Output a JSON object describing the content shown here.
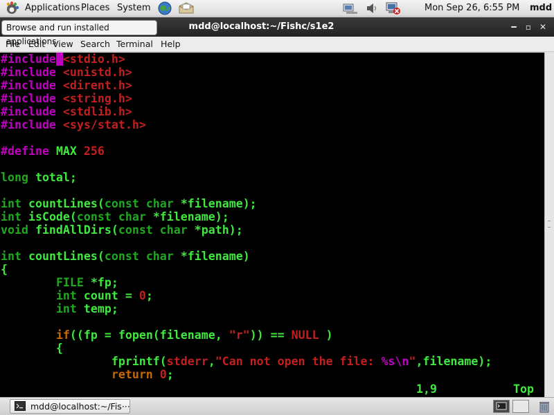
{
  "top_panel": {
    "menus": [
      "Applications",
      "Places",
      "System"
    ],
    "launchers": [
      "web-browser-icon",
      "mail-client-icon"
    ],
    "tray": [
      "network-icon",
      "volume-icon",
      "update-notifier-icon"
    ],
    "clock": "Mon Sep 26,  6:55 PM",
    "user": "mdd"
  },
  "tooltip": "Browse and run installed applications",
  "window": {
    "title": "mdd@localhost:~/Fishc/s1e2",
    "menu": [
      "File",
      "Edit",
      "View",
      "Search",
      "Terminal",
      "Help"
    ]
  },
  "editor": {
    "lines": [
      [
        [
          "pp",
          "#include"
        ],
        [
          "inc",
          "<stdio.h>"
        ]
      ],
      [
        [
          "pp",
          "#include "
        ],
        [
          "inc",
          "<unistd.h>"
        ]
      ],
      [
        [
          "pp",
          "#include "
        ],
        [
          "inc",
          "<dirent.h>"
        ]
      ],
      [
        [
          "pp",
          "#include "
        ],
        [
          "inc",
          "<string.h>"
        ]
      ],
      [
        [
          "pp",
          "#include "
        ],
        [
          "inc",
          "<stdlib.h>"
        ]
      ],
      [
        [
          "pp",
          "#include "
        ],
        [
          "inc",
          "<sys/stat.h>"
        ]
      ],
      [],
      [
        [
          "pp",
          "#define "
        ],
        [
          "id",
          "MAX "
        ],
        [
          "st",
          "256"
        ]
      ],
      [],
      [
        [
          "ty",
          "long "
        ],
        [
          "id",
          "total;"
        ]
      ],
      [],
      [
        [
          "ty",
          "int "
        ],
        [
          "id",
          "countLines("
        ],
        [
          "ty",
          "const char "
        ],
        [
          "id",
          "*filename);"
        ]
      ],
      [
        [
          "ty",
          "int "
        ],
        [
          "id",
          "isCode("
        ],
        [
          "ty",
          "const char "
        ],
        [
          "id",
          "*filename);"
        ]
      ],
      [
        [
          "ty",
          "void "
        ],
        [
          "id",
          "findAllDirs("
        ],
        [
          "ty",
          "const char "
        ],
        [
          "id",
          "*path);"
        ]
      ],
      [],
      [
        [
          "ty",
          "int "
        ],
        [
          "id",
          "countLines("
        ],
        [
          "ty",
          "const char "
        ],
        [
          "id",
          "*filename)"
        ]
      ],
      [
        [
          "id",
          "{"
        ]
      ],
      [
        [
          "id",
          "        "
        ],
        [
          "ty",
          "FILE "
        ],
        [
          "id",
          "*fp;"
        ]
      ],
      [
        [
          "id",
          "        "
        ],
        [
          "ty",
          "int "
        ],
        [
          "id",
          "count = "
        ],
        [
          "st",
          "0"
        ],
        [
          "id",
          ";"
        ]
      ],
      [
        [
          "id",
          "        "
        ],
        [
          "ty",
          "int "
        ],
        [
          "id",
          "temp;"
        ]
      ],
      [],
      [
        [
          "id",
          "        "
        ],
        [
          "kw",
          "if"
        ],
        [
          "id",
          "((fp = fopen(filename, "
        ],
        [
          "st",
          "\"r\""
        ],
        [
          "id",
          ")) == "
        ],
        [
          "st",
          "NULL"
        ],
        [
          "id",
          " )"
        ]
      ],
      [
        [
          "id",
          "        {"
        ]
      ],
      [
        [
          "id",
          "                fprintf("
        ],
        [
          "st",
          "stderr"
        ],
        [
          "id",
          ","
        ],
        [
          "st",
          "\"Can not open the file: "
        ],
        [
          "sp",
          "%s\\n"
        ],
        [
          "st",
          "\""
        ],
        [
          "id",
          ",filename);"
        ]
      ],
      [
        [
          "id",
          "                "
        ],
        [
          "kw",
          "return "
        ],
        [
          "st",
          "0"
        ],
        [
          "id",
          ";"
        ]
      ]
    ],
    "cursor_pos": "1,9",
    "scroll_pos": "Top"
  },
  "taskbar": {
    "task_label": "mdd@localhost:~/Fis···"
  }
}
